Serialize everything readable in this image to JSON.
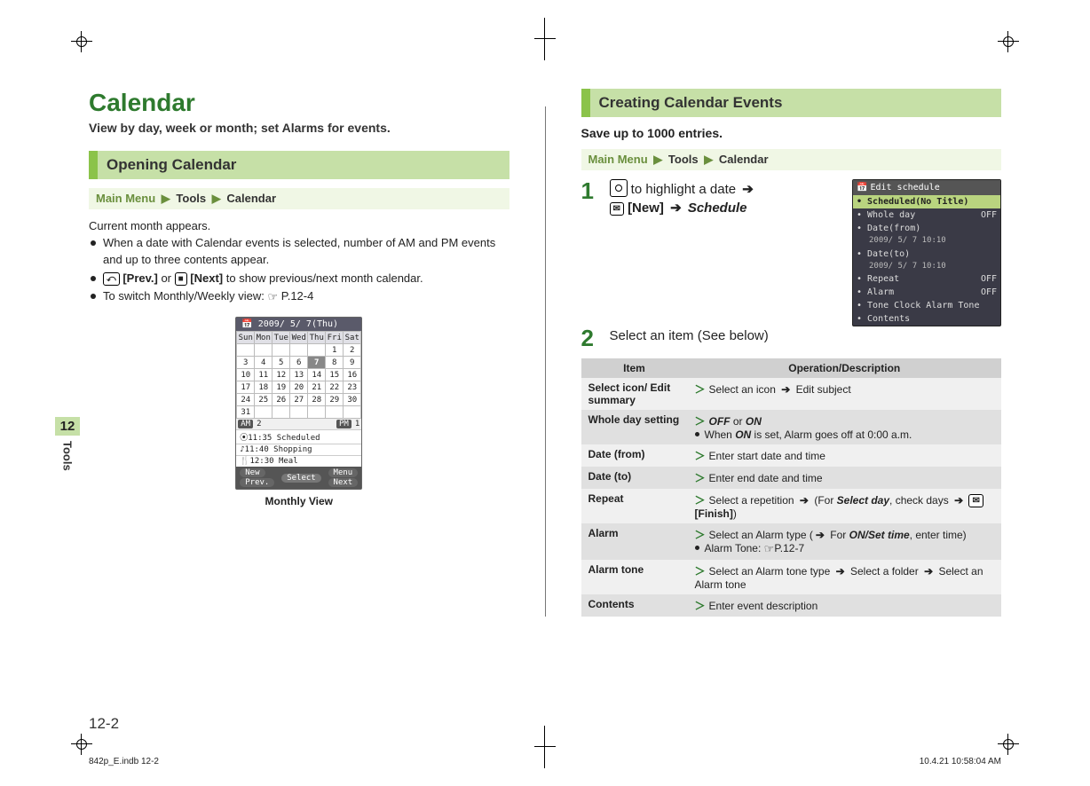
{
  "chapter": {
    "num": "12",
    "label": "Tools"
  },
  "page_number": "12-2",
  "footer": {
    "left": "842p_E.indb   12-2",
    "right": "10.4.21   10:58:04 AM"
  },
  "left": {
    "title": "Calendar",
    "subtitle": "View by day, week or month; set Alarms for events.",
    "section_head": "Opening Calendar",
    "breadcrumb": {
      "first": "Main Menu",
      "parts": [
        "Tools",
        "Calendar"
      ]
    },
    "intro": "Current month appears.",
    "bullets": [
      {
        "text_a": "When a date with Calendar events is selected, number of AM and PM events and up to three contents appear."
      },
      {
        "keycap_a": "⤺",
        "label_a": "[Prev.]",
        "mid": " or ",
        "keycap_b": "■",
        "label_b": "[Next]",
        "tail": " to show previous/next month calendar."
      },
      {
        "text_a": "To switch Monthly/Weekly view: ",
        "ref": "P.12-4"
      }
    ],
    "monthly_view": {
      "title": "2009/ 5/ 7(Thu)",
      "days": [
        "Sun",
        "Mon",
        "Tue",
        "Wed",
        "Thu",
        "Fri",
        "Sat"
      ],
      "rows": [
        [
          "",
          "",
          "",
          "",
          "",
          "1",
          "2"
        ],
        [
          "3",
          "4",
          "5",
          "6",
          "7",
          "8",
          "9"
        ],
        [
          "10",
          "11",
          "12",
          "13",
          "14",
          "15",
          "16"
        ],
        [
          "17",
          "18",
          "19",
          "20",
          "21",
          "22",
          "23"
        ],
        [
          "24",
          "25",
          "26",
          "27",
          "28",
          "29",
          "30"
        ],
        [
          "31",
          "",
          "",
          "",
          "",
          "",
          ""
        ]
      ],
      "today_cell": "7",
      "am_count": "2",
      "pm_count": "1",
      "sched": [
        "⦿11:35 Scheduled",
        "♪11:40 Shopping",
        "🍴12:30 Meal"
      ],
      "softkeys": {
        "l1": "New",
        "l2": "Prev.",
        "c": "Select",
        "r1": "Menu",
        "r2": "Next"
      },
      "caption": "Monthly View"
    }
  },
  "right": {
    "section_head": "Creating Calendar Events",
    "save_up": "Save up to 1000 entries.",
    "breadcrumb": {
      "first": "Main Menu",
      "parts": [
        "Tools",
        "Calendar"
      ]
    },
    "step1": {
      "pre": " to highlight a date ",
      "key_label": "[New]",
      "tail": "Schedule"
    },
    "step2": "Select an item (See below)",
    "edit_screen": {
      "title": "Edit schedule",
      "rows": [
        {
          "label": "Scheduled(No Title)",
          "val": "",
          "hl": true
        },
        {
          "label": "Whole day",
          "val": "OFF"
        },
        {
          "label": "Date(from)",
          "sub": "2009/ 5/ 7 10:10"
        },
        {
          "label": "Date(to)",
          "sub": "2009/ 5/ 7 10:10"
        },
        {
          "label": "Repeat",
          "val": "OFF"
        },
        {
          "label": "Alarm",
          "val": "OFF"
        },
        {
          "label": "Tone   Clock Alarm Tone",
          "val": ""
        },
        {
          "label": "Contents",
          "val": ""
        }
      ]
    },
    "table": {
      "head_item": "Item",
      "head_op": "Operation/Description",
      "rows": [
        {
          "item": "Select icon/ Edit summary",
          "lines": [
            {
              "gt": true,
              "parts": [
                "Select an icon ",
                {
                  "arrow": true
                },
                " Edit subject"
              ]
            }
          ]
        },
        {
          "item": "Whole day setting",
          "lines": [
            {
              "gt": true,
              "parts": [
                {
                  "ital": "OFF"
                },
                " or ",
                {
                  "ital": "ON"
                }
              ]
            },
            {
              "dot": true,
              "parts": [
                "When ",
                {
                  "ital": "ON"
                },
                " is set, Alarm goes off at 0:00 a.m."
              ]
            }
          ]
        },
        {
          "item": "Date (from)",
          "lines": [
            {
              "gt": true,
              "parts": [
                "Enter start date and time"
              ]
            }
          ]
        },
        {
          "item": "Date (to)",
          "lines": [
            {
              "gt": true,
              "parts": [
                "Enter end date and time"
              ]
            }
          ]
        },
        {
          "item": "Repeat",
          "lines": [
            {
              "gt": true,
              "parts": [
                "Select a repetition ",
                {
                  "arrow": true
                },
                " (For ",
                {
                  "ital": "Select day"
                },
                ", check days ",
                {
                  "arrow": true
                },
                " ",
                {
                  "keycap": "✉"
                },
                {
                  "bold": "[Finish]"
                },
                ")"
              ]
            }
          ]
        },
        {
          "item": "Alarm",
          "lines": [
            {
              "gt": true,
              "parts": [
                "Select an Alarm type (",
                {
                  "arrow": true
                },
                " For ",
                {
                  "ital": "ON/Set time"
                },
                ", enter time)"
              ]
            },
            {
              "dot": true,
              "parts": [
                "Alarm Tone: ",
                {
                  "ref": "P.12-7"
                }
              ]
            }
          ]
        },
        {
          "item": "Alarm tone",
          "lines": [
            {
              "gt": true,
              "parts": [
                "Select an Alarm tone type ",
                {
                  "arrow": true
                },
                " Select a folder ",
                {
                  "arrow": true
                },
                " Select an Alarm tone"
              ]
            }
          ]
        },
        {
          "item": "Contents",
          "lines": [
            {
              "gt": true,
              "parts": [
                "Enter event description"
              ]
            }
          ]
        }
      ]
    }
  }
}
